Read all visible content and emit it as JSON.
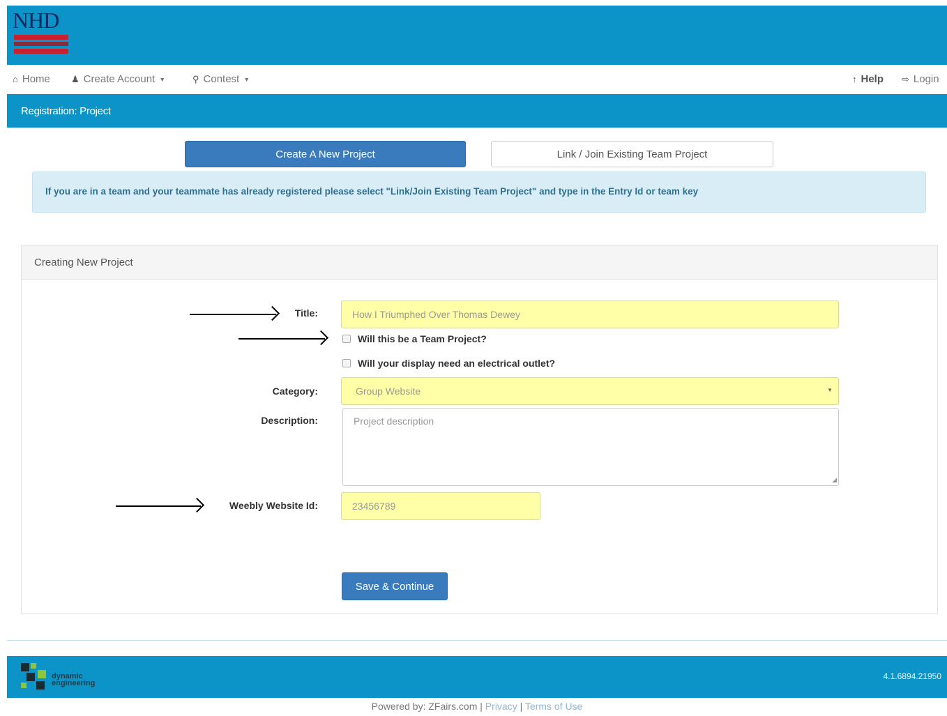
{
  "header": {
    "logo_text": "NHD"
  },
  "nav": {
    "home": "Home",
    "create_account": "Create Account",
    "contest": "Contest",
    "help": "Help",
    "login": "Login"
  },
  "subheader": {
    "title": "Registration: Project"
  },
  "tabs": {
    "create_new": "Create A New Project",
    "link_join": "Link / Join Existing Team Project"
  },
  "alert": {
    "text": "If you are in a team and your teammate has already registered please select \"Link/Join Existing Team Project\" and type in the Entry Id or team key"
  },
  "panel": {
    "heading": "Creating New Project"
  },
  "form": {
    "title_label": "Title:",
    "title_value": "How I Triumphed Over Thomas Dewey",
    "team_project_label": "Will this be a Team Project?",
    "electrical_label": "Will your display need an electrical outlet?",
    "category_label": "Category:",
    "category_value": "Group Website",
    "description_label": "Description:",
    "description_placeholder": "Project description",
    "weebly_label": "Weebly Website Id:",
    "weebly_value": "23456789",
    "save_label": "Save & Continue"
  },
  "footer": {
    "logo_line1": "dynamic",
    "logo_line2": "engineering",
    "version": "4.1.6894.21950",
    "powered_by": "Powered by: ZFairs.com",
    "separator": "|",
    "privacy": "Privacy",
    "terms": "Terms of Use"
  },
  "colors": {
    "brand_blue": "#0c93c8",
    "button_blue": "#3a7bbd",
    "highlight_yellow": "#ffffa8",
    "alert_bg": "#d9edf7"
  }
}
